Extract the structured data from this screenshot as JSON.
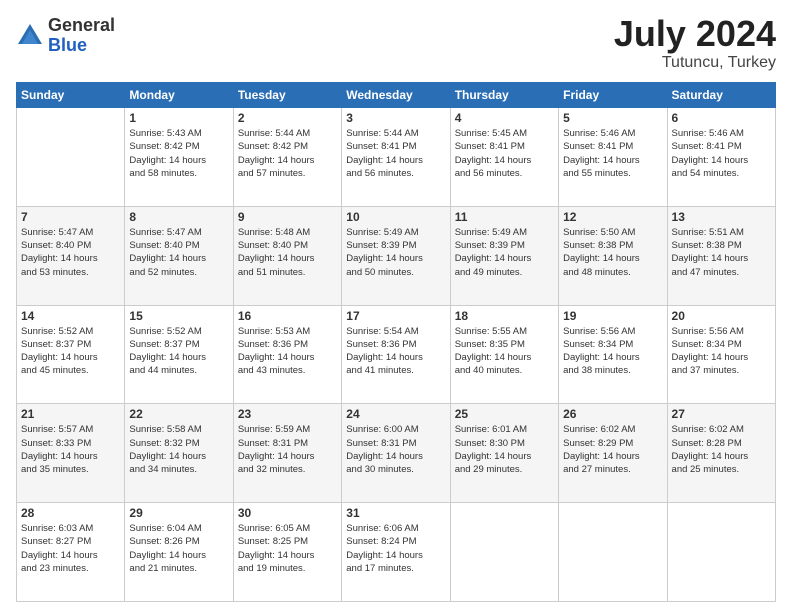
{
  "logo": {
    "general": "General",
    "blue": "Blue"
  },
  "title": {
    "month_year": "July 2024",
    "location": "Tutuncu, Turkey"
  },
  "weekdays": [
    "Sunday",
    "Monday",
    "Tuesday",
    "Wednesday",
    "Thursday",
    "Friday",
    "Saturday"
  ],
  "weeks": [
    [
      {
        "day": "",
        "info": ""
      },
      {
        "day": "1",
        "info": "Sunrise: 5:43 AM\nSunset: 8:42 PM\nDaylight: 14 hours\nand 58 minutes."
      },
      {
        "day": "2",
        "info": "Sunrise: 5:44 AM\nSunset: 8:42 PM\nDaylight: 14 hours\nand 57 minutes."
      },
      {
        "day": "3",
        "info": "Sunrise: 5:44 AM\nSunset: 8:41 PM\nDaylight: 14 hours\nand 56 minutes."
      },
      {
        "day": "4",
        "info": "Sunrise: 5:45 AM\nSunset: 8:41 PM\nDaylight: 14 hours\nand 56 minutes."
      },
      {
        "day": "5",
        "info": "Sunrise: 5:46 AM\nSunset: 8:41 PM\nDaylight: 14 hours\nand 55 minutes."
      },
      {
        "day": "6",
        "info": "Sunrise: 5:46 AM\nSunset: 8:41 PM\nDaylight: 14 hours\nand 54 minutes."
      }
    ],
    [
      {
        "day": "7",
        "info": "Sunrise: 5:47 AM\nSunset: 8:40 PM\nDaylight: 14 hours\nand 53 minutes."
      },
      {
        "day": "8",
        "info": "Sunrise: 5:47 AM\nSunset: 8:40 PM\nDaylight: 14 hours\nand 52 minutes."
      },
      {
        "day": "9",
        "info": "Sunrise: 5:48 AM\nSunset: 8:40 PM\nDaylight: 14 hours\nand 51 minutes."
      },
      {
        "day": "10",
        "info": "Sunrise: 5:49 AM\nSunset: 8:39 PM\nDaylight: 14 hours\nand 50 minutes."
      },
      {
        "day": "11",
        "info": "Sunrise: 5:49 AM\nSunset: 8:39 PM\nDaylight: 14 hours\nand 49 minutes."
      },
      {
        "day": "12",
        "info": "Sunrise: 5:50 AM\nSunset: 8:38 PM\nDaylight: 14 hours\nand 48 minutes."
      },
      {
        "day": "13",
        "info": "Sunrise: 5:51 AM\nSunset: 8:38 PM\nDaylight: 14 hours\nand 47 minutes."
      }
    ],
    [
      {
        "day": "14",
        "info": "Sunrise: 5:52 AM\nSunset: 8:37 PM\nDaylight: 14 hours\nand 45 minutes."
      },
      {
        "day": "15",
        "info": "Sunrise: 5:52 AM\nSunset: 8:37 PM\nDaylight: 14 hours\nand 44 minutes."
      },
      {
        "day": "16",
        "info": "Sunrise: 5:53 AM\nSunset: 8:36 PM\nDaylight: 14 hours\nand 43 minutes."
      },
      {
        "day": "17",
        "info": "Sunrise: 5:54 AM\nSunset: 8:36 PM\nDaylight: 14 hours\nand 41 minutes."
      },
      {
        "day": "18",
        "info": "Sunrise: 5:55 AM\nSunset: 8:35 PM\nDaylight: 14 hours\nand 40 minutes."
      },
      {
        "day": "19",
        "info": "Sunrise: 5:56 AM\nSunset: 8:34 PM\nDaylight: 14 hours\nand 38 minutes."
      },
      {
        "day": "20",
        "info": "Sunrise: 5:56 AM\nSunset: 8:34 PM\nDaylight: 14 hours\nand 37 minutes."
      }
    ],
    [
      {
        "day": "21",
        "info": "Sunrise: 5:57 AM\nSunset: 8:33 PM\nDaylight: 14 hours\nand 35 minutes."
      },
      {
        "day": "22",
        "info": "Sunrise: 5:58 AM\nSunset: 8:32 PM\nDaylight: 14 hours\nand 34 minutes."
      },
      {
        "day": "23",
        "info": "Sunrise: 5:59 AM\nSunset: 8:31 PM\nDaylight: 14 hours\nand 32 minutes."
      },
      {
        "day": "24",
        "info": "Sunrise: 6:00 AM\nSunset: 8:31 PM\nDaylight: 14 hours\nand 30 minutes."
      },
      {
        "day": "25",
        "info": "Sunrise: 6:01 AM\nSunset: 8:30 PM\nDaylight: 14 hours\nand 29 minutes."
      },
      {
        "day": "26",
        "info": "Sunrise: 6:02 AM\nSunset: 8:29 PM\nDaylight: 14 hours\nand 27 minutes."
      },
      {
        "day": "27",
        "info": "Sunrise: 6:02 AM\nSunset: 8:28 PM\nDaylight: 14 hours\nand 25 minutes."
      }
    ],
    [
      {
        "day": "28",
        "info": "Sunrise: 6:03 AM\nSunset: 8:27 PM\nDaylight: 14 hours\nand 23 minutes."
      },
      {
        "day": "29",
        "info": "Sunrise: 6:04 AM\nSunset: 8:26 PM\nDaylight: 14 hours\nand 21 minutes."
      },
      {
        "day": "30",
        "info": "Sunrise: 6:05 AM\nSunset: 8:25 PM\nDaylight: 14 hours\nand 19 minutes."
      },
      {
        "day": "31",
        "info": "Sunrise: 6:06 AM\nSunset: 8:24 PM\nDaylight: 14 hours\nand 17 minutes."
      },
      {
        "day": "",
        "info": ""
      },
      {
        "day": "",
        "info": ""
      },
      {
        "day": "",
        "info": ""
      }
    ]
  ]
}
